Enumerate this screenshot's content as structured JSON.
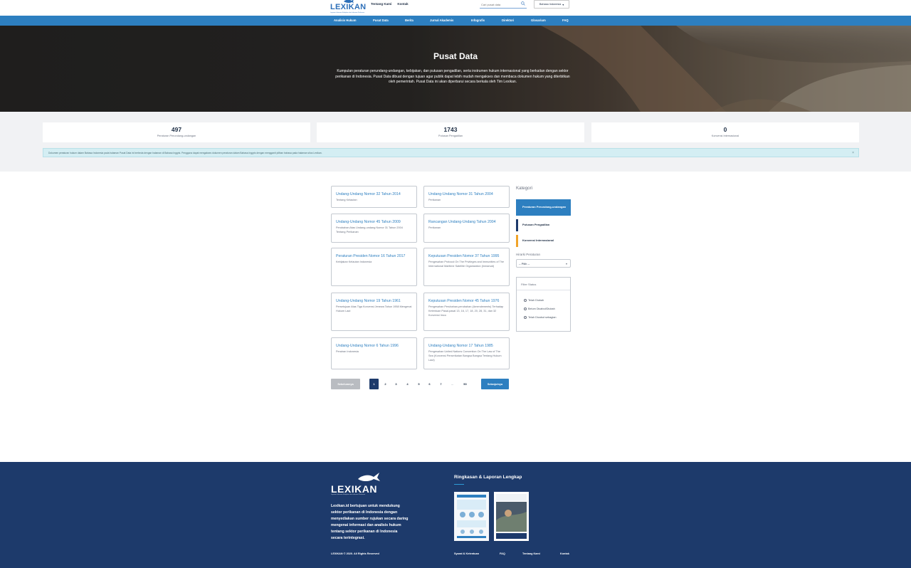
{
  "brand": {
    "name": "LEXIKAN",
    "tagline": "Layanan Informasi Kebijakan dan Informasi Perikanan"
  },
  "top_links": [
    "Tentang Kami",
    "Kontak"
  ],
  "search": {
    "placeholder": "Cari pusat data"
  },
  "language": {
    "label": "Bahasa Indonesia"
  },
  "nav": {
    "items": [
      "Analisis Hukum",
      "Pusat Data",
      "Berita",
      "Jurnal Akademis",
      "Infografis",
      "Direktori",
      "Glosarium",
      "FAQ"
    ]
  },
  "hero": {
    "title": "Pusat Data",
    "description": "Kumpulan peraturan perundang-undangan, kebijakan, dan putusan pengadilan, serta instrumen hukum internasional yang berkaitan dengan sektor perikanan di Indonesia. Pusat Data dibuat dengan tujuan agar publik dapat lebih mudah mengakses dan membaca dokumen hukum yang diterbitkan oleh pemerintah. Pusat Data ini akan diperbarui secara berkala oleh Tim Lexikan."
  },
  "stats": [
    {
      "value": "497",
      "label": "Peraturan Perundang-undangan"
    },
    {
      "value": "1743",
      "label": "Putusan Pengadilan"
    },
    {
      "value": "0",
      "label": "Konvensi Internasional"
    }
  ],
  "alert": {
    "text": "Dokumen peraturan hukum dalam Bahasa Indonesia pada halaman Pusat Data ini berbeda dengan halaman di Bahasa Inggris. Pengguna dapat mengakses dokumen peraturan dalam Bahasa Inggris dengan mengganti pilihan bahasa pada halaman situs Lexikan.",
    "close": "×"
  },
  "cards": [
    {
      "title": "Undang-Undang Nomor 32 Tahun 2014",
      "desc": "Tentang Kelautan"
    },
    {
      "title": "Undang-Undang Nomor 31 Tahun 2004",
      "desc": "Perikanan"
    },
    {
      "title": "Undang-Undang Nomor 45 Tahun 2009",
      "desc": "Perubahan Atas Undang-undang Nomor 31 Tahun 2004 Tentang Perikanan"
    },
    {
      "title": "Rancangan Undang-Undang Tahun 2004",
      "desc": "Perikanan"
    },
    {
      "title": "Peraturan Presiden Nomor 16 Tahun 2017",
      "desc": "Kebijakan Kelautan Indonesia"
    },
    {
      "title": "Keputusan Presiden Nomor 37 Tahun 1995",
      "desc": "Pengesahan Protocol On The Privileges and Immunities of The International Maritime Satellite Organization (Inmarsat)"
    },
    {
      "title": "Undang-Undang Nomor 19 Tahun 1961",
      "desc": "Persetujuan Atas Tiga Konvensi Jenewa Tahun 1958 Mengenai Hukum Laut"
    },
    {
      "title": "Keputusan Presiden Nomor 45 Tahun 1976",
      "desc": "Pengesahan Perubahan-perubahan (Amendements) Terhadap Ketentuan Pasal-pasal 13, 16, 17, 18, 20, 28, 31, dan 32 Konvensi Imco"
    },
    {
      "title": "Undang-Undang Nomor 6 Tahun 1996",
      "desc": "Perairan Indonesia"
    },
    {
      "title": "Undang-Undang Nomor 17 Tahun 1985",
      "desc": "Pengesahan United Nations Convention On The Law of The Sea (Konvensi Perserikatan Bangsa Bangsa Tentang Hukum Laut)"
    }
  ],
  "sidebar": {
    "heading": "Kategori",
    "categories": [
      {
        "label": "Peraturan Perundang-undangan",
        "color": "#2d7fc0"
      },
      {
        "label": "Putusan Pengadilan",
        "color": "#1d3a6b"
      },
      {
        "label": "Konvensi Internasional",
        "color": "#f0a429"
      }
    ],
    "hierarchy_label": "Hirarki Peraturan",
    "hierarchy_value": "-- Pilih --",
    "filter_head": "Filter Status",
    "filter_options": [
      "Telah Diubah",
      "Belum Dicabut/Diubah",
      "Telah Dicabut sebagian"
    ]
  },
  "pagination": {
    "prev": "Sebelumnya",
    "next": "Selanjutnya",
    "pages": [
      "1",
      "2",
      "3",
      "4",
      "5",
      "6",
      "7",
      "...",
      "50"
    ],
    "current": "1"
  },
  "footer": {
    "description": "Lexikan.id bertujuan untuk mendukung sektor perikanan di Indonesia dengan menyediakan sumber rujukan secara daring mengenai informasi dan analisis hukum tentang sektor perikanan di Indonesia secara terintegrasi.",
    "copyright": "LEXIKAN © 2020. All Rights Reserved",
    "reports_heading": "Ringkasan & Laporan Lengkap",
    "links": [
      "Syarat & Ketentuan",
      "FAQ",
      "Tentang Kami",
      "Kontak"
    ]
  },
  "colors": {
    "accent": "#2d7fc0",
    "navy": "#1d3a6b",
    "orange": "#f0a429"
  }
}
